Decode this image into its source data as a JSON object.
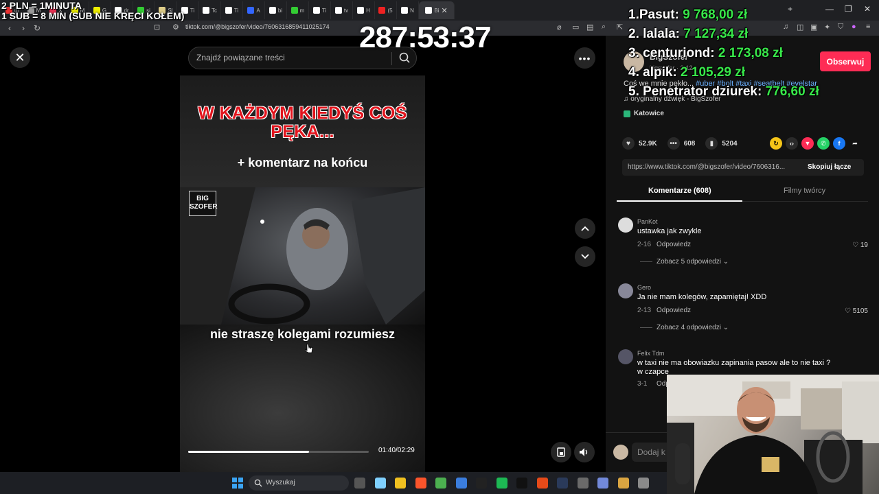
{
  "overlay": {
    "line1": "2 PLN = 1MINUTA",
    "line2": "1 SUB = 8 MIN (SUB NIE KRĘCI KOŁEM)",
    "timer": "287:53:37",
    "leaderboard": [
      {
        "name": "1.Pasut:",
        "amount": "9 768,00 zł"
      },
      {
        "name": "2. lalala:",
        "amount": "7 127,34 zł"
      },
      {
        "name": "3. centuriond:",
        "amount": "2 173,08 zł"
      },
      {
        "name": "4. alpik:",
        "amount": "2 105,29 zł"
      },
      {
        "name": "5. Penetrator dziurek:",
        "amount": "776,60 zł"
      }
    ],
    "colors": {
      "amount": "#38e84a"
    }
  },
  "browser": {
    "tabs": [
      {
        "label": "ul",
        "color": "#e33"
      },
      {
        "label": "M",
        "color": "#999"
      },
      {
        "label": "X",
        "color": "#e35"
      },
      {
        "label": "M",
        "color": "#ee0"
      },
      {
        "label": "G",
        "color": "#ee0"
      },
      {
        "label": "dr",
        "color": "#fff"
      },
      {
        "label": "si",
        "color": "#3c3"
      },
      {
        "label": "Sl",
        "color": "#dc8"
      },
      {
        "label": "Ti",
        "color": "#fff"
      },
      {
        "label": "Tc",
        "color": "#fff"
      },
      {
        "label": "Ti",
        "color": "#fff"
      },
      {
        "label": "A",
        "color": "#36f"
      },
      {
        "label": "bi",
        "color": "#fff"
      },
      {
        "label": "m",
        "color": "#3c3"
      },
      {
        "label": "Ti",
        "color": "#fff"
      },
      {
        "label": "tv",
        "color": "#fff"
      },
      {
        "label": "H",
        "color": "#fff"
      },
      {
        "label": "(5",
        "color": "#e22"
      },
      {
        "label": "N",
        "color": "#fff"
      },
      {
        "label": "Bi",
        "color": "#fff",
        "active": true
      }
    ],
    "url": "tiktok.com/@bigszofer/video/7606316859411025174"
  },
  "search": {
    "placeholder": "Znajdź powiązane treści"
  },
  "video": {
    "headline": "W KAŻDYM KIEDYŚ COŚ PĘKA...",
    "subheadline": "+ komentarz na końcu",
    "logo": "BIG SZOFER",
    "subtitle": "nie straszę kolegami rozumiesz",
    "time": "01:40/02:29",
    "progress": 0.671
  },
  "author": {
    "name": "BigSzofer",
    "sub": "bigszofer · 2-12",
    "follow_label": "Obserwuj",
    "description_text": "Coś we mnie pękło... ",
    "tags": "#uber #bolt #taxi #seatbelt #evelstar",
    "sound": "♫ oryginalny dźwięk - BigSzofer",
    "location": "Katowice"
  },
  "stats": {
    "likes": "52.9K",
    "comments": "608",
    "saves": "5204"
  },
  "link": {
    "url": "https://www.tiktok.com/@bigszofer/video/7606316...",
    "copy_label": "Skopiuj łącze"
  },
  "panel_tabs": {
    "comments": "Komentarze (608)",
    "creator_videos": "Filmy twórcy"
  },
  "comments": [
    {
      "user": "PanKot",
      "text": "ustawka jak zwykle",
      "date": "2-16",
      "reply": "Odpowiedz",
      "likes": "♡ 19",
      "more": "Zobacz 5 odpowiedzi ⌄",
      "avatar_color": "#ddd"
    },
    {
      "user": "Gero",
      "text": "Ja nie mam kolegów, zapamiętaj! XDD",
      "date": "2-13",
      "reply": "Odpowiedz",
      "likes": "♡ 5105",
      "more": "Zobacz 4 odpowiedzi ⌄",
      "avatar_color": "#889"
    },
    {
      "user": "Felix Tdm",
      "text": "w taxi nie ma obowiazku zapinania pasow ale to nie taxi ?",
      "text2": "w czapce",
      "date": "3-1",
      "reply": "Odpowiedz",
      "likes": "",
      "more": "",
      "avatar_color": "#556"
    }
  ],
  "comment_input": {
    "placeholder": "Dodaj k"
  },
  "taskbar": {
    "search_label": "Wyszukaj"
  }
}
